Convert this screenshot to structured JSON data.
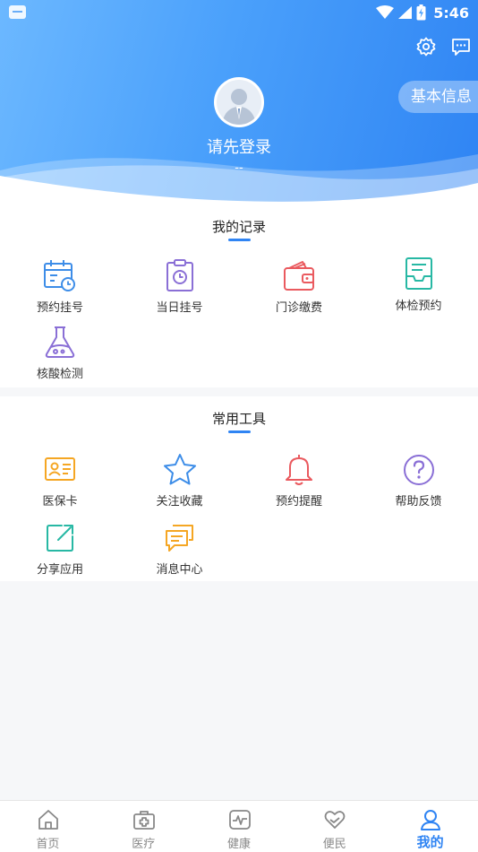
{
  "status": {
    "time": "5:46"
  },
  "header": {
    "login_text": "请先登录",
    "sub_text": "--",
    "basic_info": "基本信息",
    "icons": [
      "gear-icon",
      "message-icon"
    ]
  },
  "records": {
    "title": "我的记录",
    "items": [
      {
        "label": "预约挂号",
        "icon": "calendar-clock-icon"
      },
      {
        "label": "当日挂号",
        "icon": "clipboard-clock-icon"
      },
      {
        "label": "门诊缴费",
        "icon": "wallet-icon"
      },
      {
        "label": "体检预约",
        "icon": "inbox-tray-icon"
      },
      {
        "label": "核酸检测",
        "icon": "flask-icon"
      }
    ]
  },
  "tools": {
    "title": "常用工具",
    "items": [
      {
        "label": "医保卡",
        "icon": "id-card-icon"
      },
      {
        "label": "关注收藏",
        "icon": "star-icon"
      },
      {
        "label": "预约提醒",
        "icon": "bell-icon"
      },
      {
        "label": "帮助反馈",
        "icon": "question-icon"
      },
      {
        "label": "分享应用",
        "icon": "share-icon"
      },
      {
        "label": "消息中心",
        "icon": "chat-icon"
      }
    ]
  },
  "tabs": [
    {
      "label": "首页",
      "icon": "home-icon",
      "active": false
    },
    {
      "label": "医疗",
      "icon": "medical-kit-icon",
      "active": false
    },
    {
      "label": "健康",
      "icon": "pulse-icon",
      "active": false
    },
    {
      "label": "便民",
      "icon": "heart-hand-icon",
      "active": false
    },
    {
      "label": "我的",
      "icon": "user-icon",
      "active": true
    }
  ],
  "colors": {
    "accent": "#2f84f3",
    "blue_icon": "#3d8de8",
    "purple_icon": "#8a6fd6",
    "red_icon": "#ea5a5f",
    "teal_icon": "#27b8a4",
    "orange_icon": "#f5a623",
    "tab_inactive": "#888888"
  }
}
